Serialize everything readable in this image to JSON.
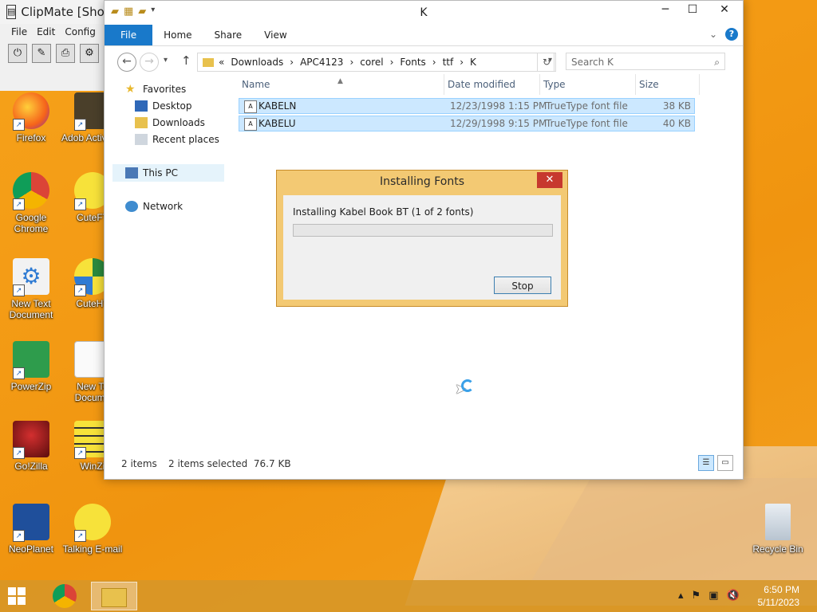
{
  "clipmate": {
    "title": "ClipMate [Shor",
    "menu": [
      "File",
      "Edit",
      "Config"
    ]
  },
  "desktop_icons": [
    {
      "label": "Firefox"
    },
    {
      "label": "Adob ActiveSh"
    },
    {
      "label": "Google Chrome"
    },
    {
      "label": "CuteFT"
    },
    {
      "label": "New Text Document"
    },
    {
      "label": "CuteHT"
    },
    {
      "label": "PowerZip"
    },
    {
      "label": "New Te Docume"
    },
    {
      "label": "Go!Zilla"
    },
    {
      "label": "WinZi"
    },
    {
      "label": "NeoPlanet"
    },
    {
      "label": "Talking E-mail"
    },
    {
      "label": "Recycle Bin"
    }
  ],
  "explorer": {
    "title": "K",
    "ribbon_tabs": [
      "File",
      "Home",
      "Share",
      "View"
    ],
    "address": {
      "chevron": "«",
      "segments": [
        "Downloads",
        "APC4123",
        "corel",
        "Fonts",
        "ttf",
        "K"
      ]
    },
    "search_placeholder": "Search K",
    "nav": {
      "favorites": "Favorites",
      "desktop": "Desktop",
      "downloads": "Downloads",
      "recent": "Recent places",
      "thispc": "This PC",
      "network": "Network"
    },
    "columns": [
      "Name",
      "Date modified",
      "Type",
      "Size"
    ],
    "files": [
      {
        "name": "KABELN",
        "date": "12/23/1998 1:15 PM",
        "type": "TrueType font file",
        "size": "38 KB"
      },
      {
        "name": "KABELU",
        "date": "12/29/1998 9:15 PM",
        "type": "TrueType font file",
        "size": "40 KB"
      }
    ],
    "status": {
      "items": "2 items",
      "selected": "2 items selected  76.7 KB"
    }
  },
  "dialog": {
    "title": "Installing Fonts",
    "message": "Installing Kabel Book BT (1 of 2 fonts)",
    "progress_fraction": 0.0,
    "stop_label": "Stop",
    "close_glyph": "✕"
  },
  "taskbar": {
    "time": "6:50 PM",
    "date": "5/11/2023"
  },
  "colors": {
    "accent": "#1979ca",
    "selection": "#cce8ff",
    "dialog_frame": "#f3c973",
    "close_red": "#c7382e"
  }
}
